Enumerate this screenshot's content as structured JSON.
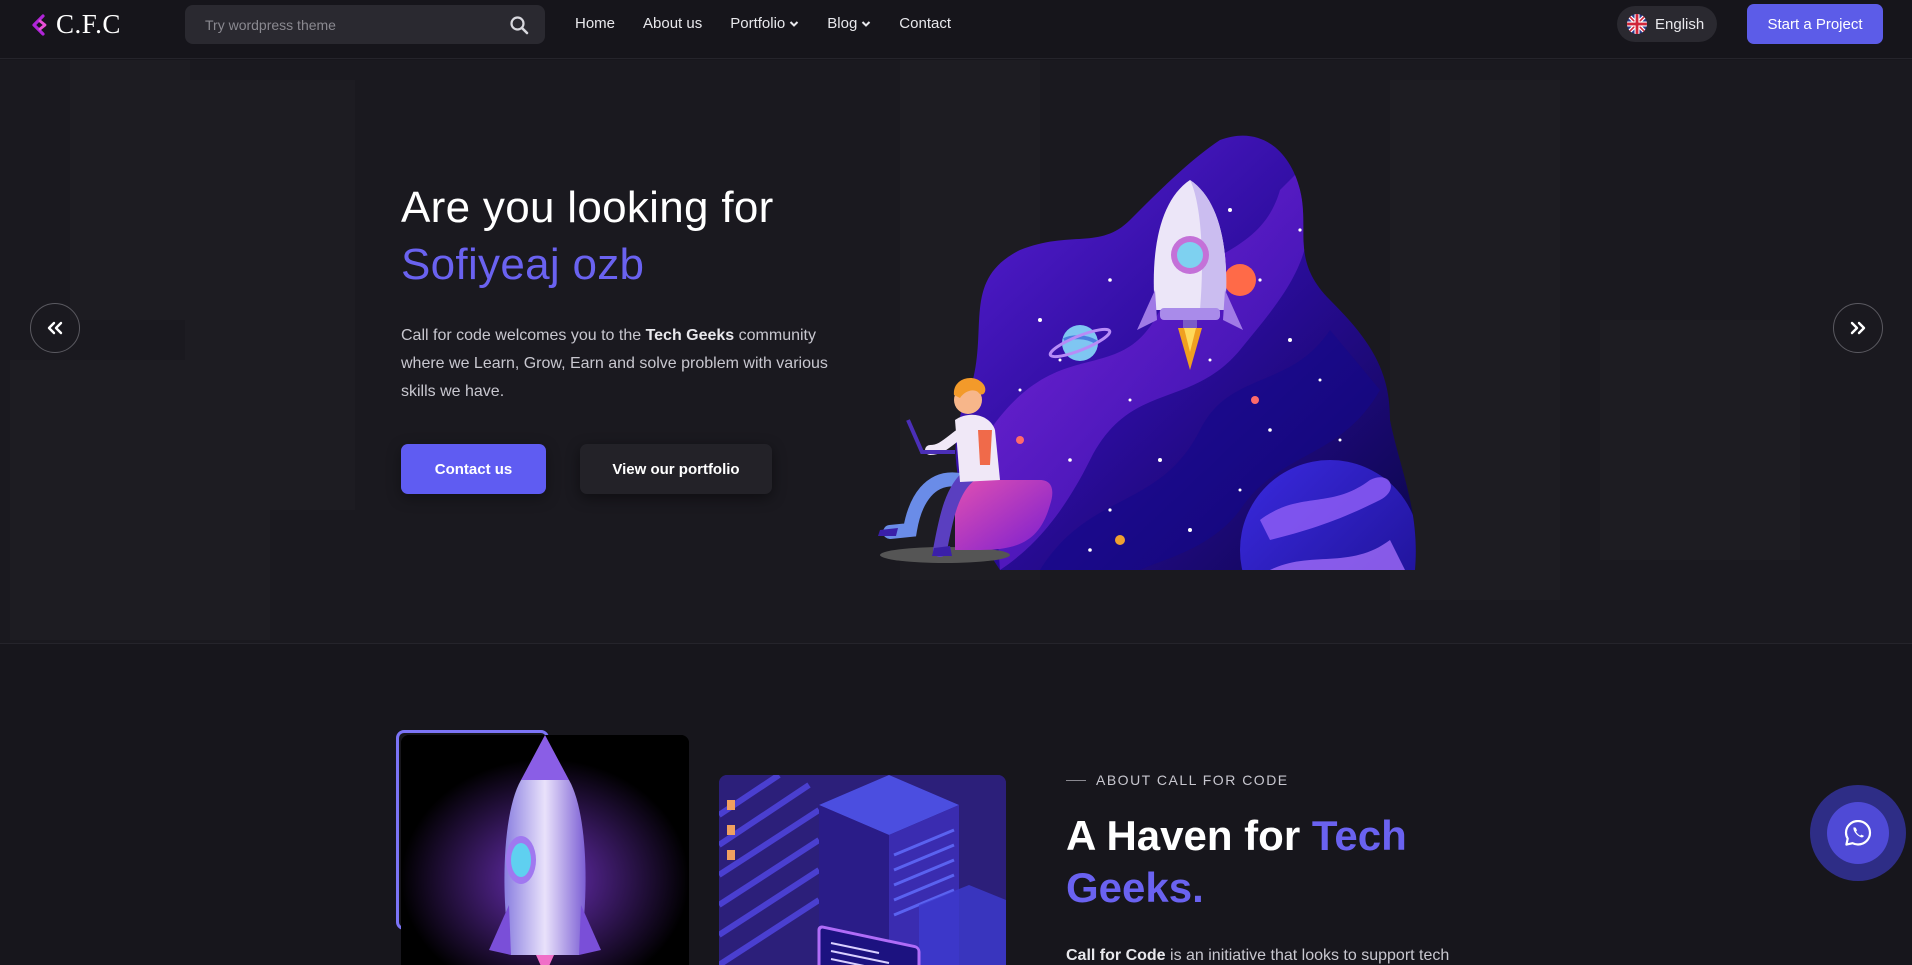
{
  "header": {
    "logo_text": "C.F.C",
    "search_placeholder": "Try wordpress theme",
    "nav": [
      {
        "label": "Home",
        "has_dropdown": false
      },
      {
        "label": "About us",
        "has_dropdown": false
      },
      {
        "label": "Portfolio",
        "has_dropdown": true
      },
      {
        "label": "Blog",
        "has_dropdown": true
      },
      {
        "label": "Contact",
        "has_dropdown": false
      }
    ],
    "language": "English",
    "cta_label": "Start a Project"
  },
  "hero": {
    "title_line1": "Are you looking for",
    "title_line2": "Sofiyeaj ozb",
    "desc_before": "Call for code welcomes you to the ",
    "desc_bold": "Tech Geeks",
    "desc_after": " community where we Learn, Grow, Earn and solve problem with various skills we have.",
    "primary_button": "Contact us",
    "secondary_button": "View our portfolio",
    "prev_icon": "double-chevron-left-icon",
    "next_icon": "double-chevron-right-icon"
  },
  "about": {
    "eyebrow": "ABOUT CALL FOR CODE",
    "title_plain": "A Haven for ",
    "title_accent": "Tech Geeks.",
    "text_bold": "Call for Code",
    "text_rest": " is an initiative that looks to support tech"
  },
  "floating": {
    "chat_icon": "whatsapp-icon"
  },
  "colors": {
    "accent": "#5f5cf2",
    "accent_text": "#6a62f0",
    "background": "#17161c"
  }
}
